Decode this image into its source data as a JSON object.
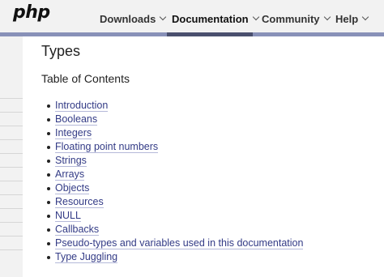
{
  "header": {
    "logo": "php",
    "nav": [
      {
        "label": "Downloads",
        "active": false
      },
      {
        "label": "Documentation",
        "active": true
      },
      {
        "label": "Community",
        "active": false
      },
      {
        "label": "Help",
        "active": false
      }
    ]
  },
  "main": {
    "title": "Types",
    "toc_heading": "Table of Contents",
    "toc": [
      "Introduction",
      "Booleans",
      "Integers",
      "Floating point numbers",
      "Strings",
      "Arrays",
      "Objects",
      "Resources",
      "NULL",
      "Callbacks",
      "Pseudo-types and variables used in this documentation",
      "Type Juggling"
    ]
  },
  "colors": {
    "link": "#333b86",
    "nav_bar": "#8891b8",
    "nav_active": "#4a4f6e"
  }
}
